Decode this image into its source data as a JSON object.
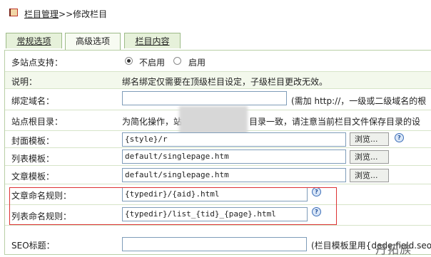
{
  "header": {
    "crumb_link": "栏目管理",
    "crumb_sep": ">>",
    "crumb_current": "修改栏目"
  },
  "tabs": [
    {
      "label": "常规选项"
    },
    {
      "label": "高级选项"
    },
    {
      "label": "栏目内容"
    }
  ],
  "rows": {
    "multisite": {
      "label": "多站点支持：",
      "opt_off": "不启用",
      "opt_on": "启用",
      "selected": "不启用"
    },
    "note": {
      "label": "说明：",
      "text": "绑名绑定仅需要在顶级栏目设定，子级栏目更改无效。"
    },
    "bind_domain": {
      "label": "绑定域名：",
      "value": "",
      "hint": "(需加 http://，一级或二级域名的根"
    },
    "site_root": {
      "label": "站点根目录：",
      "text_left": "为简化操作，站",
      "text_right": "目录一致，请注意当前栏目文件保存目录的设"
    },
    "cover_tpl": {
      "label": "封面模板：",
      "value": "{style}/r",
      "browse": "浏览..."
    },
    "list_tpl": {
      "label": "列表模板：",
      "value": "default/singlepage.htm",
      "browse": "浏览..."
    },
    "article_tpl": {
      "label": "文章模板：",
      "value": "default/singlepage.htm",
      "browse": "浏览..."
    },
    "article_rule": {
      "label": "文章命名规则：",
      "value": "{typedir}/{aid}.html"
    },
    "list_rule": {
      "label": "列表命名规则：",
      "value": "{typedir}/list_{tid}_{page}.html"
    },
    "seo_title": {
      "label": "SEO标题：",
      "value": "",
      "hint": "(栏目模板里用{dede:field.seo"
    }
  },
  "icons": {
    "help": "?"
  },
  "watermark": "丹拓族"
}
